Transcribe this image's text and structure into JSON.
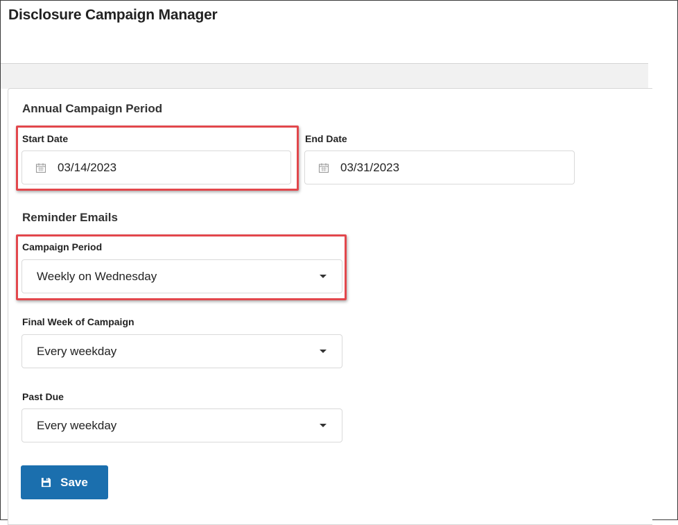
{
  "app": {
    "title": "Disclosure Campaign Manager"
  },
  "annual_campaign": {
    "section_title": "Annual Campaign Period",
    "start_date": {
      "label": "Start Date",
      "value": "03/14/2023",
      "icon": "calendar-icon"
    },
    "end_date": {
      "label": "End Date",
      "value": "03/31/2023",
      "icon": "calendar-icon"
    }
  },
  "reminder_emails": {
    "section_title": "Reminder Emails",
    "campaign_period": {
      "label": "Campaign Period",
      "value": "Weekly on Wednesday"
    },
    "final_week": {
      "label": "Final Week of Campaign",
      "value": "Every weekday"
    },
    "past_due": {
      "label": "Past Due",
      "value": "Every weekday"
    }
  },
  "actions": {
    "save_label": "Save",
    "save_icon": "floppy-disk-icon"
  },
  "colors": {
    "primary": "#1b6fae",
    "highlight": "#e2474c",
    "border": "#d9d9d9",
    "header_band": "#f1f1f1"
  }
}
